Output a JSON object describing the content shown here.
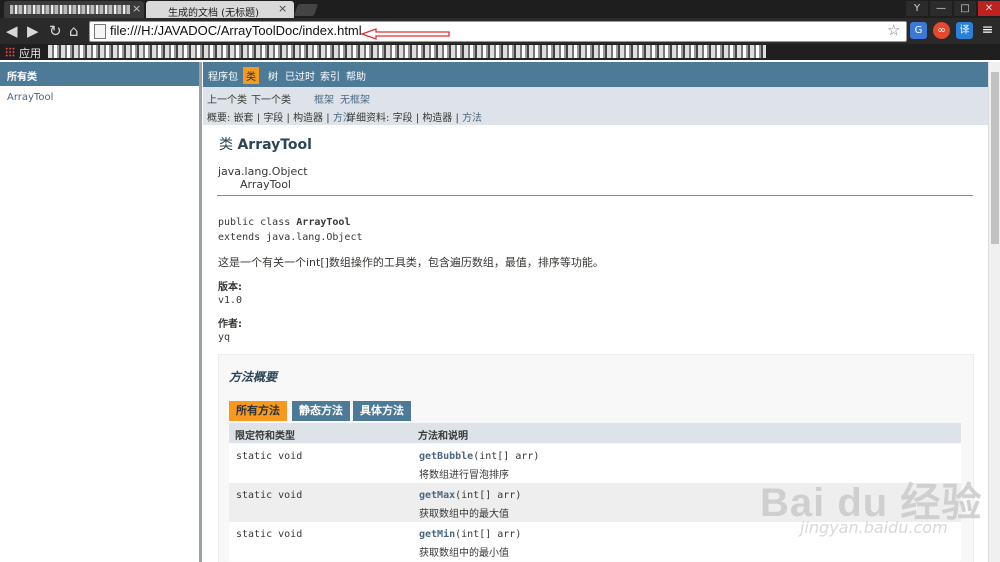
{
  "browser": {
    "active_tab_title": "生成的文档 (无标题)",
    "tab_close": "×",
    "url": "file:///H:/JAVADOC/ArrayToolDoc/index.html",
    "apps_label": "应用",
    "window_buttons": [
      "Y",
      "—",
      "□",
      "✕"
    ],
    "extensions": [
      {
        "label": "G",
        "color": "#3b78d8"
      },
      {
        "label": "∞",
        "color": "#e2492f"
      },
      {
        "label": "译",
        "color": "#2a7fd8"
      },
      {
        "label": "≡",
        "color": "#2a2a2a"
      }
    ]
  },
  "left_frame": {
    "title": "所有类",
    "items": [
      "ArrayTool"
    ]
  },
  "nav": {
    "top": [
      "程序包",
      "类",
      "树",
      "已过时",
      "索引",
      "帮助"
    ],
    "prev_class": "上一个类",
    "next_class": "下一个类",
    "frames": "框架",
    "no_frames": "无框架",
    "summary_label": "概要:",
    "summary_nested": "嵌套",
    "summary_field": "字段",
    "summary_constr": "构造器",
    "summary_method": "方法",
    "detail_label": "详细资料:",
    "detail_field": "字段",
    "detail_constr": "构造器",
    "detail_method": "方法",
    "sep": "|"
  },
  "class_doc": {
    "title_prefix": "类",
    "title_name": "ArrayTool",
    "inherit_parent": "java.lang.Object",
    "inherit_child": "ArrayTool",
    "decl_prefix": "public class",
    "decl_name": "ArrayTool",
    "decl_extends": "extends java.lang.Object",
    "description": "这是一个有关一个int[]数组操作的工具类，包含遍历数组，最值，排序等功能。",
    "version_label": "版本:",
    "version_value": "v1.0",
    "author_label": "作者:",
    "author_value": "yq"
  },
  "method_summary": {
    "title": "方法概要",
    "tabs": [
      "所有方法",
      "静态方法",
      "具体方法"
    ],
    "col_modifier": "限定符和类型",
    "col_method": "方法和说明",
    "rows": [
      {
        "modifier": "static void",
        "name": "getBubble",
        "params": "(int[]  arr)",
        "desc": "将数组进行冒泡排序"
      },
      {
        "modifier": "static void",
        "name": "getMax",
        "params": "(int[]  arr)",
        "desc": "获取数组中的最大值"
      },
      {
        "modifier": "static void",
        "name": "getMin",
        "params": "(int[]  arr)",
        "desc": "获取数组中的最小值"
      }
    ]
  },
  "watermark": {
    "main": "Bai du 经验",
    "sub": "jingyan.baidu.com"
  },
  "colors": {
    "nav_blue": "#4d7a97",
    "nav_active": "#f8981d",
    "subnav_bg": "#dee3e9",
    "annotation_red": "#e03030"
  }
}
